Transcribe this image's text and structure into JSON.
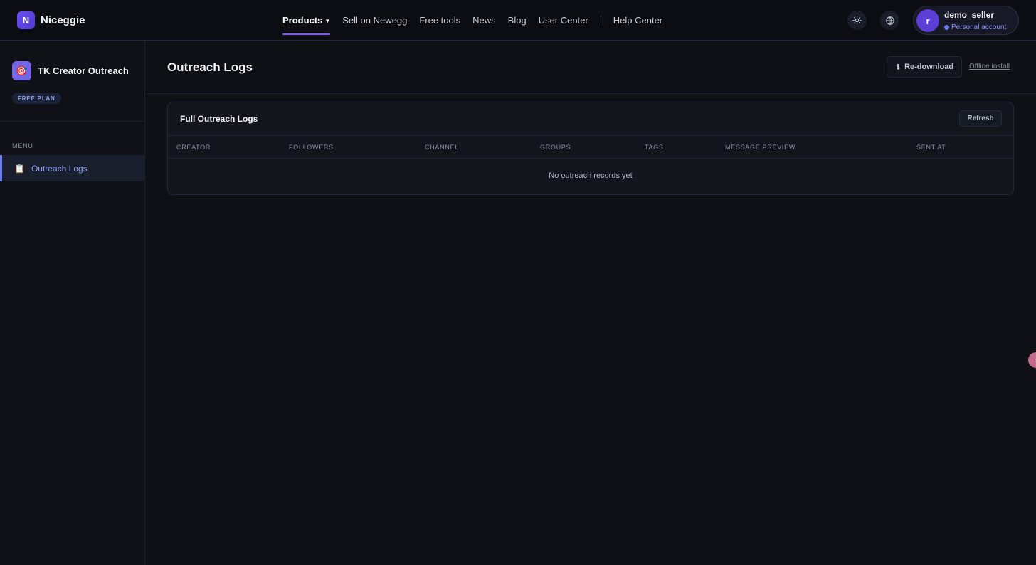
{
  "brand": {
    "logo_letter": "N",
    "name": "Niceggie"
  },
  "nav": {
    "items": [
      {
        "label": "Products",
        "active": true,
        "has_caret": true
      },
      {
        "label": "Sell on Newegg"
      },
      {
        "label": "Free tools"
      },
      {
        "label": "News"
      },
      {
        "label": "Blog"
      },
      {
        "label": "User Center"
      },
      {
        "label": "Help Center"
      }
    ]
  },
  "header_icons": {
    "theme": "sun-icon",
    "language": "globe-icon"
  },
  "user": {
    "avatar_letter": "r",
    "name": "demo_seller",
    "account_type": "Personal account"
  },
  "sidebar": {
    "app_icon": "target-icon",
    "app_title": "TK Creator Outreach",
    "plan": "FREE PLAN",
    "menu_label": "MENU",
    "items": [
      {
        "label": "Outreach Logs",
        "icon": "clipboard-icon",
        "active": true
      }
    ]
  },
  "page": {
    "title": "Outreach Logs",
    "redownload_label": "Re-download",
    "offline_label": "Offline install"
  },
  "card": {
    "title": "Full Outreach Logs",
    "refresh_label": "Refresh",
    "columns": [
      "CREATOR",
      "FOLLOWERS",
      "CHANNEL",
      "GROUPS",
      "TAGS",
      "MESSAGE PREVIEW",
      "SENT AT"
    ],
    "empty_text": "No outreach records yet"
  },
  "colors": {
    "accent": "#7c5cff",
    "background": "#0e1015",
    "sidebar_active": "#8ea0f5"
  }
}
